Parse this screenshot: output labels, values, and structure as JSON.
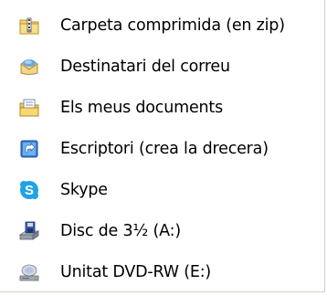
{
  "menu": {
    "items": [
      {
        "label": "Carpeta comprimida (en zip)",
        "icon": "zip-folder-icon"
      },
      {
        "label": "Destinatari del correu",
        "icon": "mail-recipient-icon"
      },
      {
        "label": "Els meus documents",
        "icon": "my-documents-icon"
      },
      {
        "label": "Escriptori (crea la drecera)",
        "icon": "desktop-shortcut-icon"
      },
      {
        "label": "Skype",
        "icon": "skype-icon"
      },
      {
        "label": "Disc de 3½ (A:)",
        "icon": "floppy-drive-icon"
      },
      {
        "label": "Unitat DVD-RW (E:)",
        "icon": "dvd-drive-icon"
      }
    ]
  },
  "colors": {
    "highlight": "#316ac5",
    "border": "#d4d0c8",
    "text": "#000000"
  }
}
